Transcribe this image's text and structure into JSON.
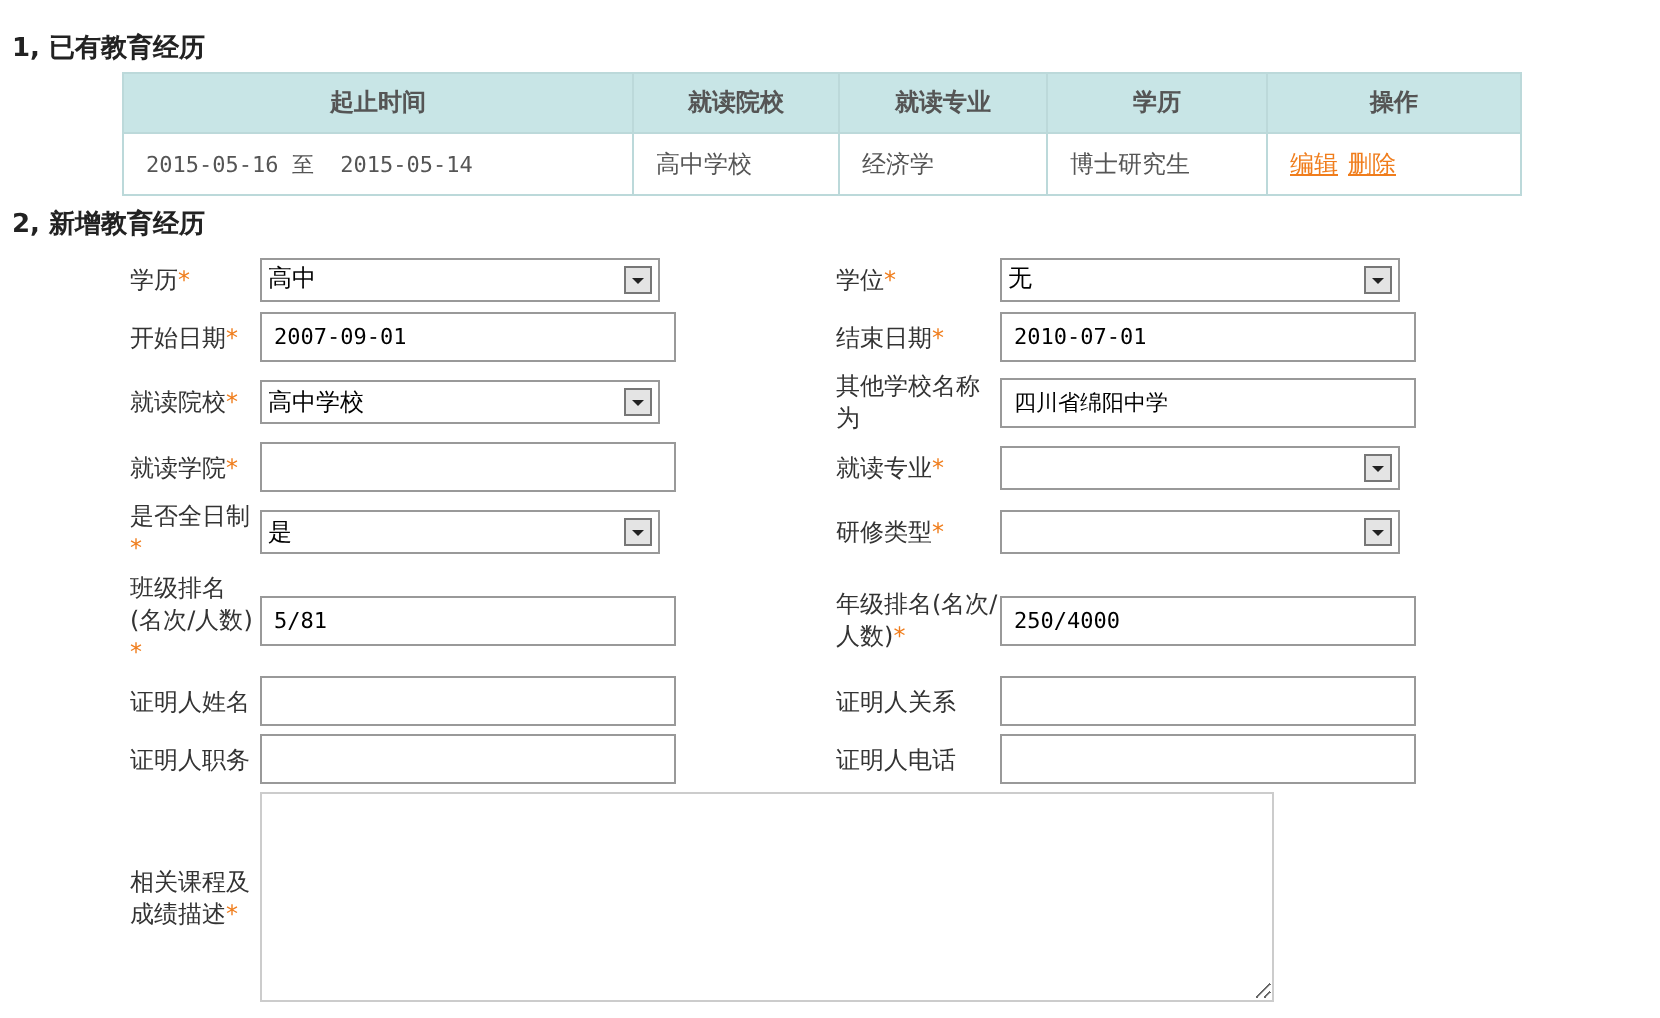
{
  "existing": {
    "heading": "1, 已有教育经历",
    "columns": [
      "起止时间",
      "就读院校",
      "就读专业",
      "学历",
      "操作"
    ],
    "rows": [
      {
        "start": "2015-05-16",
        "sep": "至",
        "end": "2015-05-14",
        "school": "高中学校",
        "major": "经济学",
        "degree": "博士研究生",
        "actions": [
          "编辑",
          "删除"
        ]
      }
    ]
  },
  "form": {
    "heading": "2, 新增教育经历",
    "rows": [
      [
        {
          "label": "学历",
          "mark": "*",
          "kind": "select",
          "value": "高中"
        },
        {
          "label": "学位",
          "mark": "*",
          "kind": "select",
          "value": "无"
        }
      ],
      [
        {
          "label": "开始日期",
          "mark": "*",
          "kind": "input",
          "value": "2007-09-01"
        },
        {
          "label": "结束日期",
          "mark": "*",
          "kind": "input",
          "value": "2010-07-01"
        }
      ],
      [
        {
          "label": "就读院校",
          "mark": "*",
          "kind": "select",
          "value": "高中学校"
        },
        {
          "label": "其他学校名称为",
          "kind": "input",
          "value": "四川省绵阳中学"
        }
      ],
      [
        {
          "label": "就读学院",
          "mark": "*",
          "kind": "input"
        },
        {
          "label": "就读专业",
          "mark": "*",
          "kind": "select"
        }
      ],
      [
        {
          "label": "是否全日制",
          "mark": "*",
          "kind": "select",
          "value": "是"
        },
        {
          "label": "研修类型",
          "mark": "*",
          "kind": "select"
        }
      ],
      [
        {
          "label": "班级排名(名次/人数)",
          "mark": "*",
          "kind": "input",
          "value": "5/81"
        },
        {
          "label": "年级排名(名次/人数)",
          "mark": "*",
          "kind": "input",
          "value": "250/4000"
        }
      ],
      [
        {
          "label": "证明人姓名",
          "kind": "input"
        },
        {
          "label": "证明人关系",
          "kind": "input"
        }
      ],
      [
        {
          "label": "证明人职务",
          "kind": "input"
        },
        {
          "label": "证明人电话",
          "kind": "input"
        }
      ],
      [
        {
          "label": "相关课程及成绩描述",
          "mark": "*",
          "kind": "textarea"
        }
      ]
    ]
  }
}
